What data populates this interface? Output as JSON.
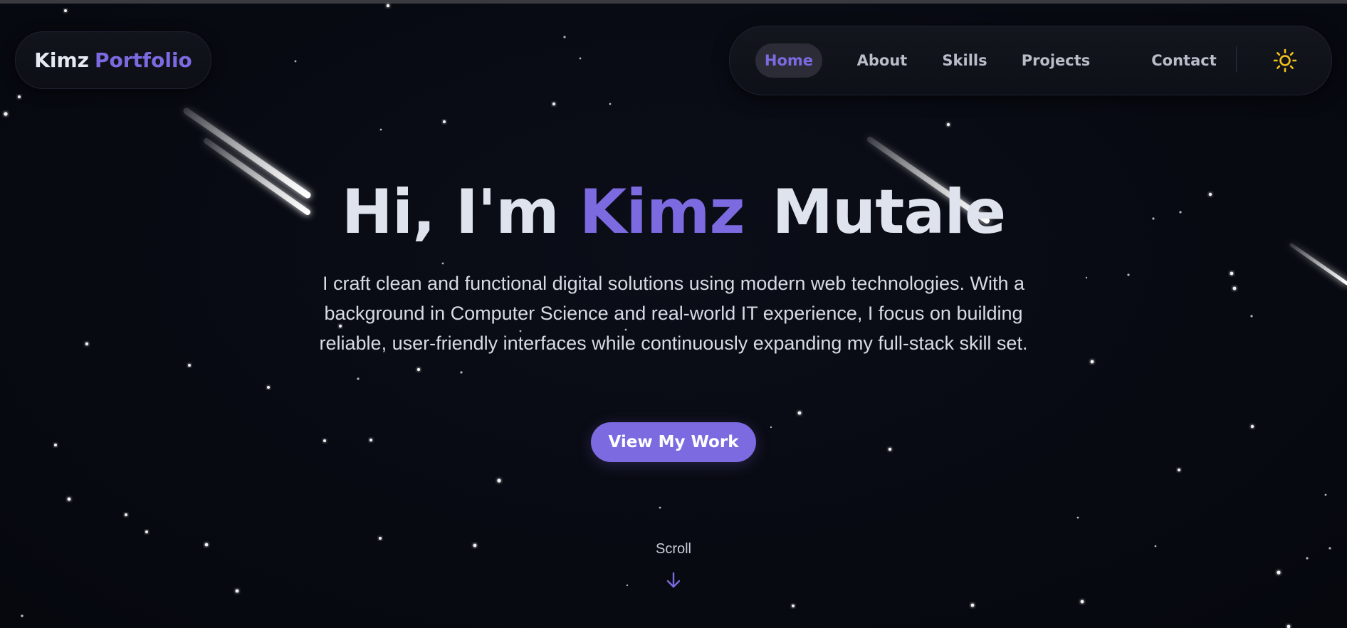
{
  "brand": {
    "first": "Kimz",
    "second": "Portfolio"
  },
  "nav": {
    "items": [
      {
        "label": "Home",
        "active": true
      },
      {
        "label": "About",
        "active": false
      },
      {
        "label": "Skills",
        "active": false
      },
      {
        "label": "Projects",
        "active": false
      },
      {
        "label": "Contact",
        "active": false
      }
    ],
    "theme_icon": "sun-icon"
  },
  "hero": {
    "greeting": "Hi, I'm",
    "name_first": "Kimz",
    "name_last": "Mutale",
    "description": "I craft clean and functional digital solutions using modern web technologies. With a background in Computer Science and real-world IT experience, I focus on building reliable, user-friendly interfaces while continuously expanding my full-stack skill set.",
    "cta_label": "View My Work"
  },
  "scroll": {
    "label": "Scroll",
    "icon": "arrow-down-icon"
  },
  "colors": {
    "background": "#080a12",
    "accent": "#7b6ae0",
    "text": "#dfe3ee",
    "sun": "#f2c21b"
  }
}
